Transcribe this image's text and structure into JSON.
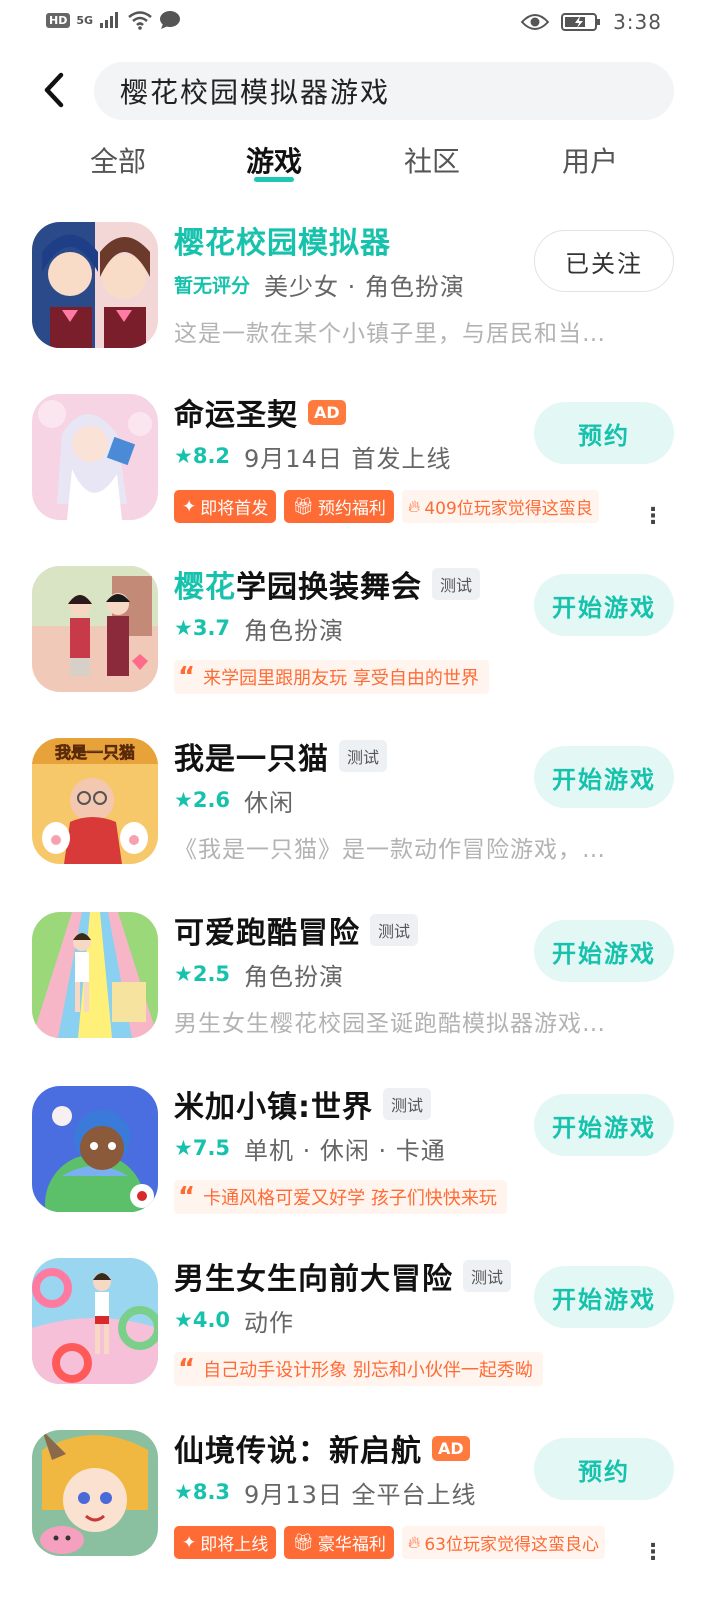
{
  "status_bar": {
    "hd": "HD",
    "network": "5G",
    "time": "3:38"
  },
  "search": {
    "query": "樱花校园模拟器游戏"
  },
  "tabs": [
    {
      "label": "全部",
      "active": false
    },
    {
      "label": "游戏",
      "active": true
    },
    {
      "label": "社区",
      "active": false
    },
    {
      "label": "用户",
      "active": false
    }
  ],
  "items": [
    {
      "title": "樱花校园模拟器",
      "rating": "暂无评分",
      "meta": "美少女 · 角色扮演",
      "desc": "这是一款在某个小镇子里，与居民和当…",
      "action": "已关注",
      "icon": "anime-girls-icon"
    },
    {
      "title": "命运圣契",
      "badge": "AD",
      "rating": "★8.2",
      "meta": "9月14日 首发上线",
      "tags": [
        "即将首发",
        "预约福利"
      ],
      "fire_text": "409位玩家觉得这蛮良",
      "action": "预约",
      "icon": "fantasy-girl-icon"
    },
    {
      "title_highlight": "樱花",
      "title_rest": "学园换装舞会",
      "badge": "测试",
      "rating": "★3.7",
      "meta": "角色扮演",
      "quote": "来学园里跟朋友玩 享受自由的世界",
      "action": "开始游戏",
      "icon": "school-couple-icon"
    },
    {
      "title": "我是一只猫",
      "badge": "测试",
      "rating": "★2.6",
      "meta": "休闲",
      "desc": "《我是一只猫》是一款动作冒险游戏，…",
      "action": "开始游戏",
      "icon": "cat-game-icon",
      "icon_text": "我是一只猫"
    },
    {
      "title": "可爱跑酷冒险",
      "badge": "测试",
      "rating": "★2.5",
      "meta": "角色扮演",
      "desc": "男生女生樱花校园圣诞跑酷模拟器游戏…",
      "action": "开始游戏",
      "icon": "parkour-icon"
    },
    {
      "title": "米加小镇:世界",
      "badge": "测试",
      "rating": "★7.5",
      "meta": "单机 · 休闲 · 卡通",
      "quote": "卡通风格可爱又好学 孩子们快快来玩",
      "action": "开始游戏",
      "icon": "toca-world-icon"
    },
    {
      "title": "男生女生向前大冒险",
      "badge": "测试",
      "rating": "★4.0",
      "meta": "动作",
      "quote": "自己动手设计形象 别忘和小伙伴一起秀呦",
      "action": "开始游戏",
      "icon": "runner-girl-icon"
    },
    {
      "title": "仙境传说：新启航",
      "badge": "AD",
      "rating": "★8.3",
      "meta": "9月13日 全平台上线",
      "tags": [
        "即将上线",
        "豪华福利"
      ],
      "fire_text": "63位玩家觉得这蛮良心",
      "action": "预约",
      "icon": "ragnarok-icon"
    }
  ],
  "colors": {
    "accent": "#17c2ad",
    "orange": "#ff6b35",
    "button_bg": "#e3f8f5"
  }
}
